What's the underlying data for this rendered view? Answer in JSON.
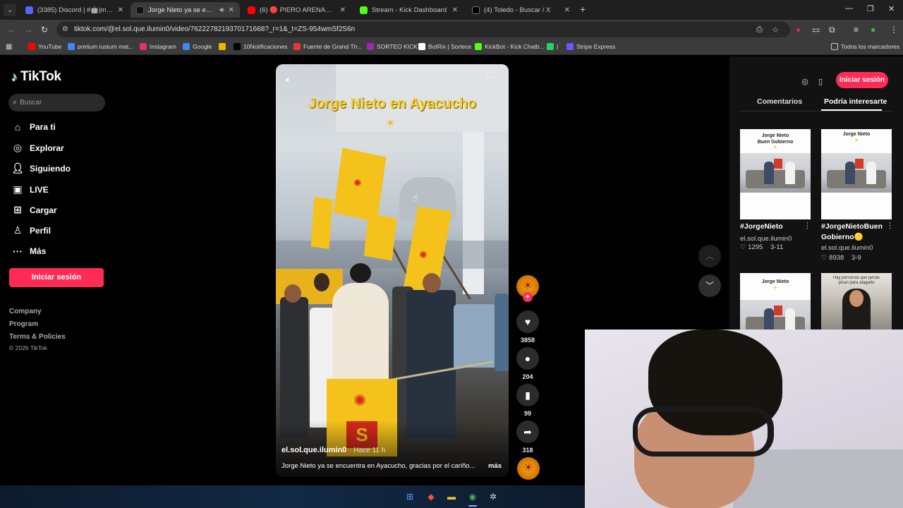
{
  "browser": {
    "tabs": [
      {
        "title": "(3385) Discord | #🤖|memes",
        "fav_color": "#5865f2"
      },
      {
        "title": "Jorge Nieto ya se encuentra",
        "fav_color": "#111111"
      },
      {
        "title": "(6) 🔴 PIERO ARENAS será ¿DE",
        "fav_color": "#ff0000"
      },
      {
        "title": "Stream - Kick Dashboard",
        "fav_color": "#53fc18"
      },
      {
        "title": "(4) Toledo - Buscar / X",
        "fav_color": "#000000"
      }
    ],
    "url": "tiktok.com/@el.sol.que.ilumin0/video/7622278219370171668?_r=1&_t=ZS-954wmSf2S6n",
    "bookmarks": [
      {
        "label": "YouTube",
        "color": "#ff0000"
      },
      {
        "label": "pretium iustum mat...",
        "color": "#4285f4"
      },
      {
        "label": "Instagram",
        "color": "#e1306c"
      },
      {
        "label": "Google",
        "color": "#4285f4"
      },
      {
        "label": "",
        "color": "#f4b400"
      },
      {
        "label": "10Notificaciones",
        "color": "#000000"
      },
      {
        "label": "Fuente de Grand Th...",
        "color": "#e53935"
      },
      {
        "label": "SORTEO KICK",
        "color": "#9c27b0"
      },
      {
        "label": "BotRix | Sorteos",
        "color": "#ffffff"
      },
      {
        "label": "KickBot - Kick Chatb...",
        "color": "#53fc18"
      },
      {
        "label": "|",
        "color": "#25d366"
      },
      {
        "label": "Stripe Express",
        "color": "#635bff"
      }
    ],
    "all_bookmarks": "Todos los marcadores"
  },
  "sidebar": {
    "logo": "TikTok",
    "search_placeholder": "Buscar",
    "nav": [
      {
        "label": "Para ti",
        "icon": "home-icon"
      },
      {
        "label": "Explorar",
        "icon": "compass-icon"
      },
      {
        "label": "Siguiendo",
        "icon": "following-icon"
      },
      {
        "label": "LIVE",
        "icon": "live-icon"
      },
      {
        "label": "Cargar",
        "icon": "upload-icon"
      },
      {
        "label": "Perfil",
        "icon": "profile-icon"
      },
      {
        "label": "Más",
        "icon": "more-icon"
      }
    ],
    "login": "Iniciar sesión",
    "footer": [
      "Company",
      "Program",
      "Terms & Policies"
    ],
    "copyright": "© 2026 TikTok"
  },
  "video": {
    "overlay_title": "Jorge Nieto en Ayacucho",
    "author": "el.sol.que.ilumin0",
    "time": "· Hace 11 h",
    "caption": "Jorge Nieto ya se encuentra en Ayacucho, gracias por el cariño...",
    "more": "más",
    "likes": "3858",
    "comments": "204",
    "saves": "99",
    "shares": "318"
  },
  "right_panel": {
    "login": "Iniciar sesión",
    "tabs": [
      "Comentarios",
      "Podría interesarte"
    ],
    "items": [
      {
        "thumb_title": "Jorge Nieto\nBuen Gobierno",
        "title": "#JorgeNieto",
        "user": "el.sol.que.ilumin0",
        "likes": "♡ 1295",
        "date": "3-11"
      },
      {
        "thumb_title": "Jorge Nieto",
        "title": "#JorgeNietoBuen Gobierno🟡",
        "user": "el.sol.que.ilumin0",
        "likes": "♡ 8938",
        "date": "3-9"
      },
      {
        "thumb_title": "Jorge Nieto"
      },
      {
        "thumb_title": "Hay personas que jamás\npisan para alagarlo"
      }
    ]
  },
  "colors": {
    "accent": "#fe2c55",
    "flag_yellow": "#f5c21b",
    "flag_red": "#d62a1a"
  }
}
